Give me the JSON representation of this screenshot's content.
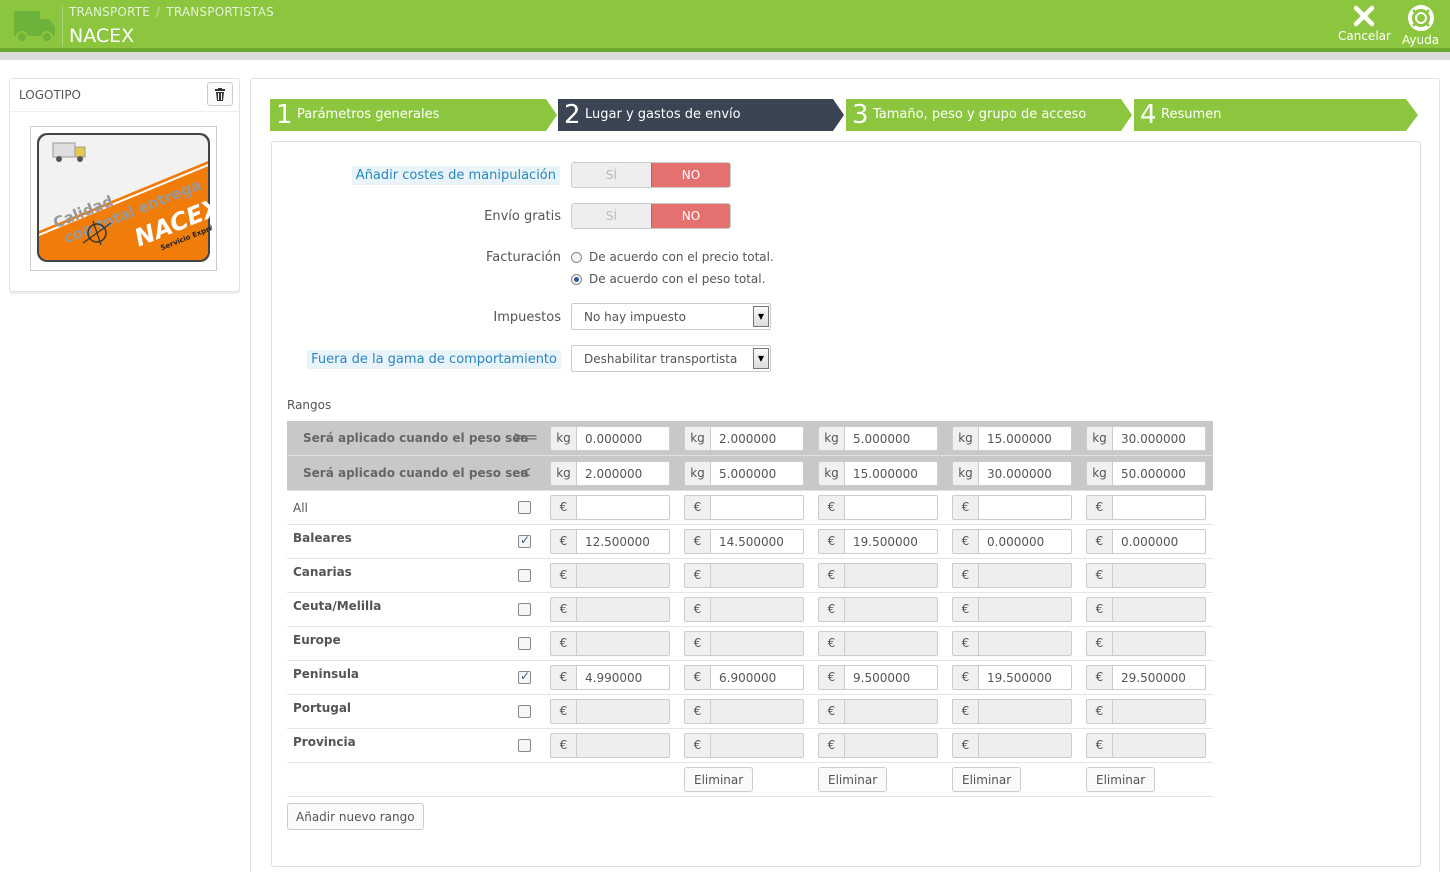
{
  "header": {
    "breadcrumb": [
      "TRANSPORTE",
      "TRANSPORTISTAS"
    ],
    "title": "NACEX",
    "cancel_label": "Cancelar",
    "help_label": "Ayuda",
    "bg_color": "#8cc63f"
  },
  "logo_panel": {
    "title": "LOGOTIPO",
    "logo_text_1": "Calidad",
    "logo_text_2": "con total entrega",
    "logo_brand": "NACEX",
    "logo_tag": "Servicio Exprés"
  },
  "steps": [
    {
      "num": "1",
      "label": "Parámetros generales",
      "active": false
    },
    {
      "num": "2",
      "label": "Lugar y gastos de envío",
      "active": true
    },
    {
      "num": "3",
      "label": "Tamaño, peso y grupo de acceso",
      "active": false
    },
    {
      "num": "4",
      "label": "Resumen",
      "active": false
    }
  ],
  "form": {
    "handling_label": "Añadir costes de manipulación",
    "free_label": "Envío gratis",
    "yes": "SÍ",
    "no": "NO",
    "billing_label": "Facturación",
    "billing_opt1": "De acuerdo con el precio total.",
    "billing_opt2": "De acuerdo con el peso total.",
    "tax_label": "Impuestos",
    "tax_value": "No hay impuesto",
    "outrange_label": "Fuera de la gama de comportamiento",
    "outrange_value": "Deshabilitar transportista",
    "ranges_title": "Rangos"
  },
  "ranges": {
    "row_label": "Será aplicado cuando el peso sea",
    "op_gte": ">=",
    "op_lt": "<",
    "unit": "kg",
    "currency": "€",
    "from": [
      "0.000000",
      "2.000000",
      "5.000000",
      "15.000000",
      "30.000000"
    ],
    "to": [
      "2.000000",
      "5.000000",
      "15.000000",
      "30.000000",
      "50.000000"
    ],
    "delete_label": "Eliminar",
    "add_label": "Añadir nuevo rango"
  },
  "zones": [
    {
      "name": "All",
      "checked": false,
      "bold": false,
      "prices": [
        "",
        "",
        "",
        "",
        ""
      ]
    },
    {
      "name": "Baleares",
      "checked": true,
      "bold": true,
      "prices": [
        "12.500000",
        "14.500000",
        "19.500000",
        "0.000000",
        "0.000000"
      ]
    },
    {
      "name": "Canarias",
      "checked": false,
      "bold": true,
      "prices": [
        "",
        "",
        "",
        "",
        ""
      ]
    },
    {
      "name": "Ceuta/Melilla",
      "checked": false,
      "bold": true,
      "prices": [
        "",
        "",
        "",
        "",
        ""
      ]
    },
    {
      "name": "Europe",
      "checked": false,
      "bold": true,
      "prices": [
        "",
        "",
        "",
        "",
        ""
      ]
    },
    {
      "name": "Peninsula",
      "checked": true,
      "bold": true,
      "prices": [
        "4.990000",
        "6.900000",
        "9.500000",
        "19.500000",
        "29.500000"
      ]
    },
    {
      "name": "Portugal",
      "checked": false,
      "bold": true,
      "prices": [
        "",
        "",
        "",
        "",
        ""
      ]
    },
    {
      "name": "Provincia",
      "checked": false,
      "bold": true,
      "prices": [
        "",
        "",
        "",
        "",
        ""
      ]
    }
  ]
}
